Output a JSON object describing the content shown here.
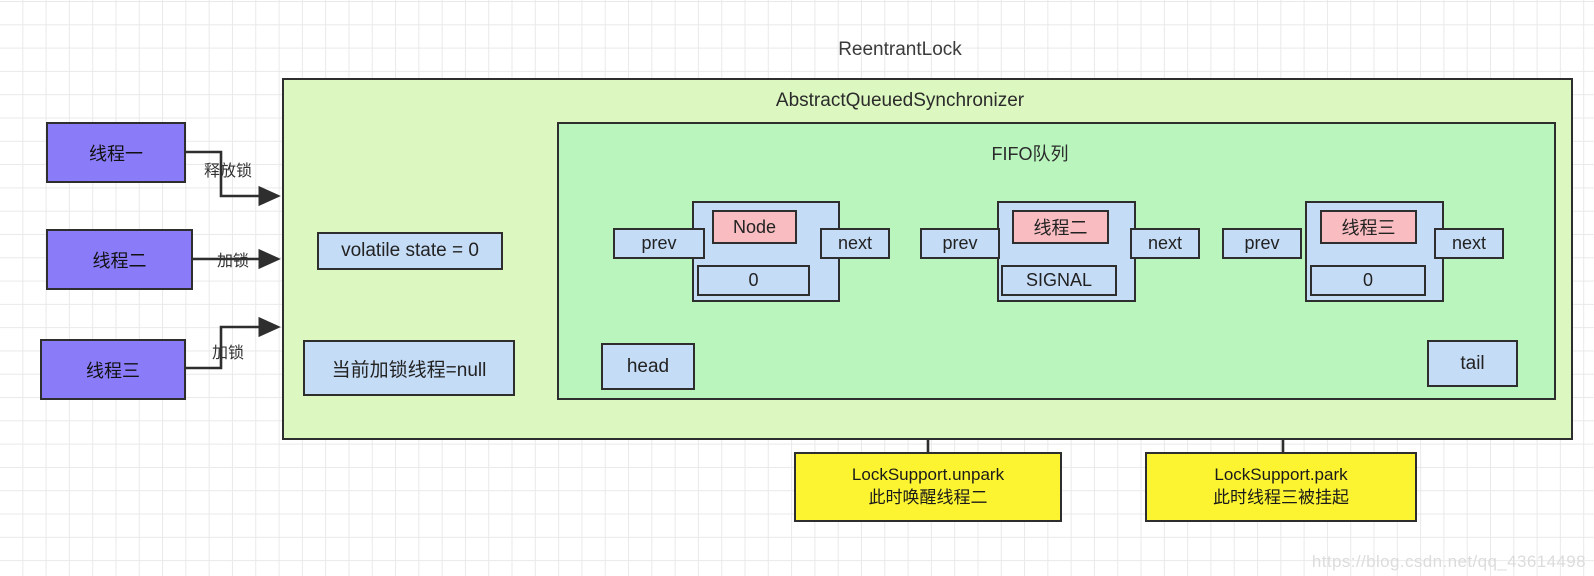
{
  "diagram": {
    "outer_title": "ReentrantLock",
    "aqs_title": "AbstractQueuedSynchronizer",
    "fifo_title": "FIFO队列",
    "watermark": "https://blog.csdn.net/qq_43614498"
  },
  "threads": [
    {
      "label": "线程一",
      "edge": "释放锁"
    },
    {
      "label": "线程二",
      "edge": "加锁"
    },
    {
      "label": "线程三",
      "edge": "加锁"
    }
  ],
  "aqs_fields": [
    {
      "label": "volatile state = 0"
    },
    {
      "label": "当前加锁线程=null"
    }
  ],
  "queue": {
    "head_label": "head",
    "tail_label": "tail",
    "nodes": [
      {
        "prev": "prev",
        "next": "next",
        "title": "Node",
        "title_kind": "pink",
        "state": "0"
      },
      {
        "prev": "prev",
        "next": "next",
        "title": "线程二",
        "title_kind": "pink",
        "state": "SIGNAL"
      },
      {
        "prev": "prev",
        "next": "next",
        "title": "线程三",
        "title_kind": "pink",
        "state": "0"
      }
    ]
  },
  "callouts": [
    {
      "line1": "LockSupport.unpark",
      "line2": "此时唤醒线程二"
    },
    {
      "line1": "LockSupport.park",
      "line2": "此时线程三被挂起"
    }
  ],
  "colors": {
    "container_outer": "#ddf7c0",
    "container_inner": "#b9f5bd",
    "thread": "#8a7cf8",
    "blue": "#c5dcf7",
    "pink": "#f9bcc0",
    "yellow": "#fcf430",
    "stroke": "#2e2e2e"
  }
}
